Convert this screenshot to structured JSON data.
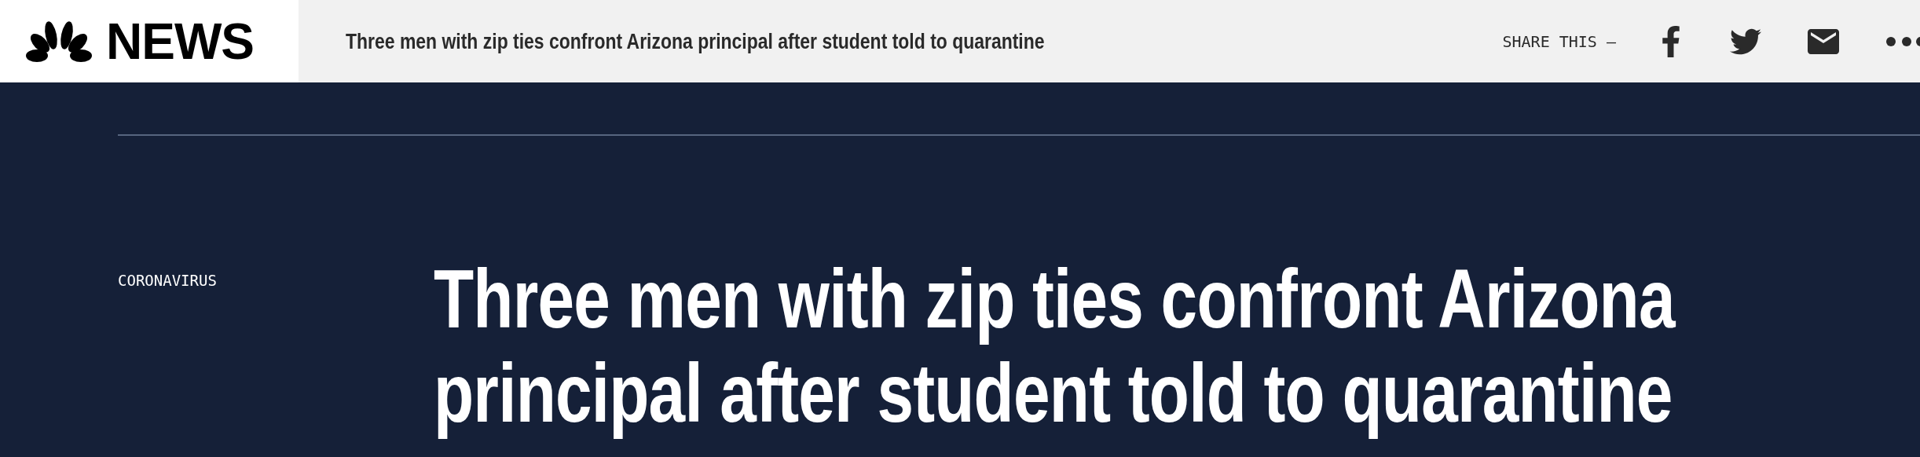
{
  "header": {
    "logo_text": "NEWS",
    "title": "Three men with zip ties confront Arizona principal after student told to quarantine",
    "share_label": "SHARE THIS —"
  },
  "article": {
    "category": "CORONAVIRUS",
    "headline": "Three men with zip ties confront Arizona principal after student told to quarantine"
  }
}
